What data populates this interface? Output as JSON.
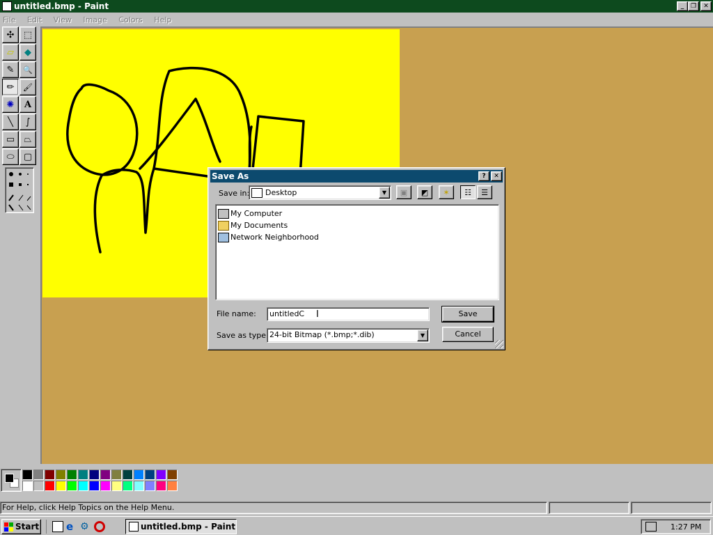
{
  "window": {
    "title": "untitled.bmp - Paint",
    "minimize": "_",
    "restore": "❐",
    "close": "✕"
  },
  "menu": {
    "items": [
      {
        "label": "File",
        "icon": "underline-F"
      },
      {
        "label": "Edit"
      },
      {
        "label": "View"
      },
      {
        "label": "Image"
      },
      {
        "label": "Colors"
      },
      {
        "label": "Help"
      }
    ]
  },
  "tools": [
    "free-select-icon",
    "rect-select-icon",
    "eraser-icon",
    "fill-icon",
    "color-picker-icon",
    "magnifier-icon",
    "pencil-icon",
    "brush-icon",
    "airbrush-icon",
    "text-icon",
    "line-icon",
    "curve-icon",
    "rectangle-icon",
    "polygon-icon",
    "ellipse-icon",
    "rounded-rect-icon"
  ],
  "tool_glyphs": [
    "✣",
    "⬚",
    "▱",
    "◆",
    "✎",
    "🔍",
    "✏",
    "🖌",
    "✺",
    "A",
    "╲",
    "∫",
    "▭",
    "⏢",
    "⬭",
    "▢"
  ],
  "colors": {
    "canvas": "#ffff00",
    "workspace": "#c8a050",
    "title_bar": "#0d4a1e",
    "dialog_title": "#0c4a6e",
    "palette_top": [
      "#000000",
      "#808080",
      "#800000",
      "#808000",
      "#008000",
      "#008080",
      "#000080",
      "#800080",
      "#808040",
      "#004040",
      "#0080ff",
      "#004080",
      "#8000ff",
      "#804000"
    ],
    "palette_bottom": [
      "#ffffff",
      "#c0c0c0",
      "#ff0000",
      "#ffff00",
      "#00ff00",
      "#00ffff",
      "#0000ff",
      "#ff00ff",
      "#ffff80",
      "#00ff80",
      "#80ffff",
      "#8080ff",
      "#ff0080",
      "#ff8040"
    ],
    "foreground": "#000000",
    "background": "#ffffff"
  },
  "status": {
    "help": "For Help, click Help Topics on the Help Menu."
  },
  "dialog": {
    "title": "Save As",
    "help_button": "?",
    "close_button": "✕",
    "save_in_label": "Save in:",
    "save_in_value": "Desktop",
    "items": [
      {
        "label": "My Computer",
        "icon": "computer-icon"
      },
      {
        "label": "My Documents",
        "icon": "folder-icon"
      },
      {
        "label": "Network Neighborhood",
        "icon": "network-icon"
      }
    ],
    "file_name_label": "File name:",
    "file_name_value": "untitledC",
    "save_type_label": "Save as type:",
    "save_type_value": "24-bit Bitmap (*.bmp;*.dib)",
    "save_button": "Save",
    "cancel_button": "Cancel"
  },
  "taskbar": {
    "start": "Start",
    "task": "untitled.bmp - Paint",
    "clock": "1:27 PM"
  }
}
